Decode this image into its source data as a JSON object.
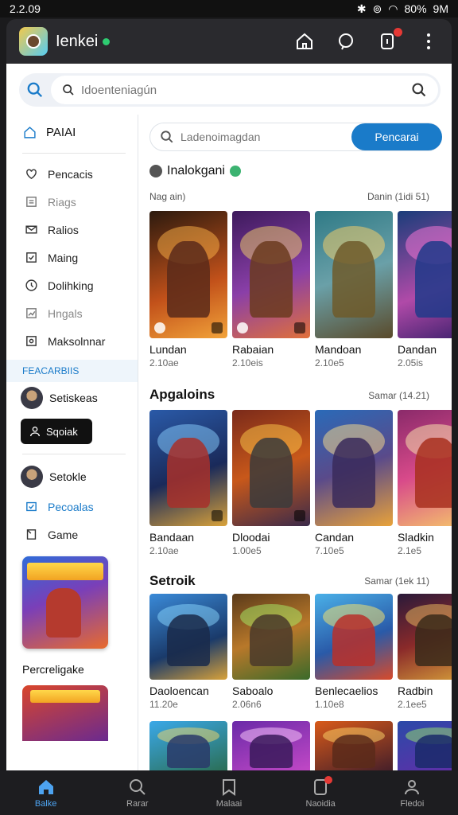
{
  "status_bar": {
    "time": "2.2.09",
    "battery": "80%",
    "signal": "9M"
  },
  "header": {
    "title": "Ienkei"
  },
  "search": {
    "placeholder": "Idoenteniagún"
  },
  "sidebar": {
    "home_label": "PAIAI",
    "items": [
      {
        "label": "Pencacis",
        "icon": "heart-icon"
      },
      {
        "label": "Riags",
        "icon": "list-icon"
      },
      {
        "label": "Ralios",
        "icon": "mail-icon"
      },
      {
        "label": "Maing",
        "icon": "check-square-icon"
      },
      {
        "label": "Dolihking",
        "icon": "clock-icon"
      },
      {
        "label": "Hngals",
        "icon": "chart-icon"
      },
      {
        "label": "Maksolnnar",
        "icon": "box-icon"
      }
    ],
    "section_label": "FEACARBIIS",
    "user1_name": "Setiskeas",
    "dark_button_label": "Sqoiak",
    "user2_name": "Setokle",
    "link_label": "Pecoalas",
    "game_label": "Game",
    "featured_label": "Percreligake"
  },
  "main": {
    "search_placeholder": "Ladenoimagdan",
    "search_button": "Pencarai",
    "section1": {
      "title": "Inalokgani",
      "meta_left": "Nag ain)",
      "meta_right": "Danin (1idi 51)"
    },
    "row1": [
      {
        "name": "Lundan",
        "stat": "2.10ae"
      },
      {
        "name": "Rabaian",
        "stat": "2.10eis"
      },
      {
        "name": "Mandoan",
        "stat": "2.10e5"
      },
      {
        "name": "Dandan",
        "stat": "2.05is"
      }
    ],
    "section2": {
      "title": "Apgaloins",
      "meta_right": "Samar (14.21)"
    },
    "row2": [
      {
        "name": "Bandaan",
        "stat": "2.10ae"
      },
      {
        "name": "Dloodai",
        "stat": "1.00e5"
      },
      {
        "name": "Candan",
        "stat": "7.10e5"
      },
      {
        "name": "Sladkin",
        "stat": "2.1e5"
      }
    ],
    "section3": {
      "title": "Setroik",
      "meta_right": "Samar (1ek 11)"
    },
    "row3": [
      {
        "name": "Daoloencan",
        "stat": "11.20e"
      },
      {
        "name": "Saboalo",
        "stat": "2.06n6"
      },
      {
        "name": "Benlecaelios",
        "stat": "1.10e8"
      },
      {
        "name": "Radbin",
        "stat": "2.1ee5"
      }
    ]
  },
  "bottom_nav": [
    {
      "label": "Balke",
      "icon": "home-icon"
    },
    {
      "label": "Rarar",
      "icon": "search-icon"
    },
    {
      "label": "Malaai",
      "icon": "bookmark-icon"
    },
    {
      "label": "Naoidia",
      "icon": "notification-icon"
    },
    {
      "label": "Fledoi",
      "icon": "profile-icon"
    }
  ],
  "colors": {
    "accent": "#1a7bc9",
    "header_bg": "#2a2a2e",
    "nav_active": "#4da3f0"
  }
}
